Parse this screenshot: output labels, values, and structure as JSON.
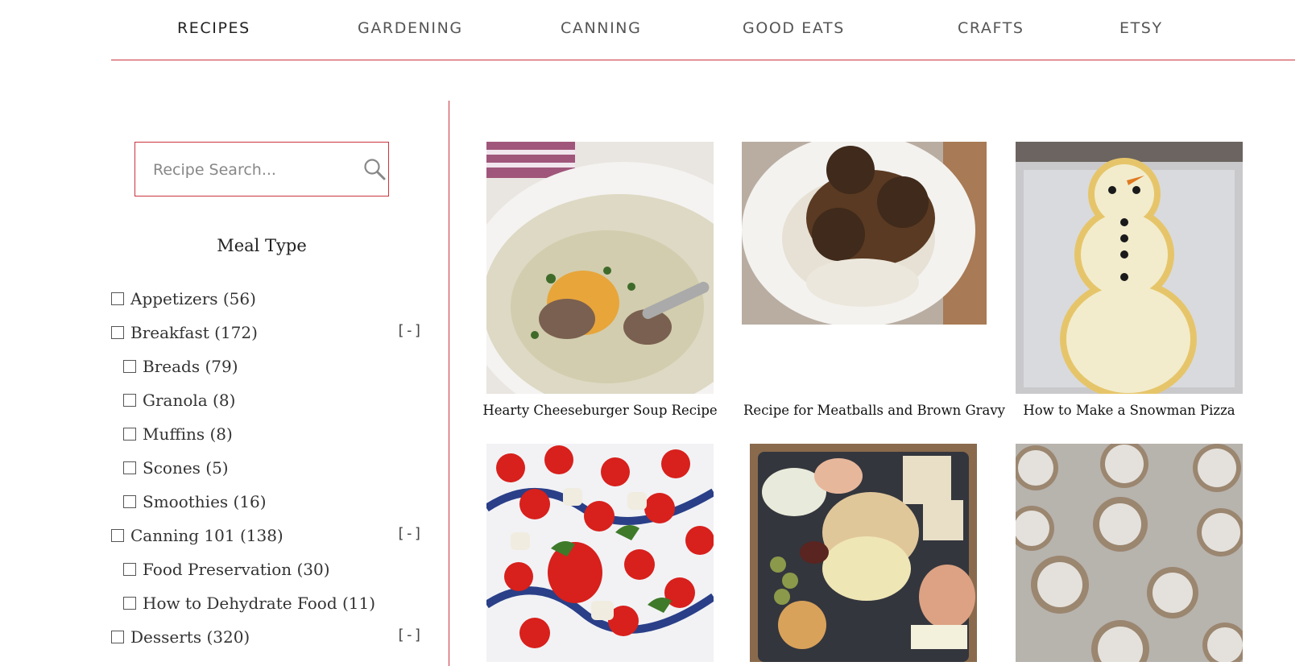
{
  "nav": {
    "items": [
      {
        "label": "RECIPES",
        "active": true
      },
      {
        "label": "GARDENING",
        "active": false
      },
      {
        "label": "CANNING",
        "active": false
      },
      {
        "label": "GOOD EATS",
        "active": false
      },
      {
        "label": "CRAFTS",
        "active": false
      },
      {
        "label": "ETSY",
        "active": false
      }
    ],
    "accent_color": "#c9353f"
  },
  "search": {
    "placeholder": "Recipe Search...",
    "value": "",
    "icon": "search-icon"
  },
  "sidebar": {
    "facet_title": "Meal Type",
    "items": [
      {
        "label": "Appetizers (56)",
        "level": 0,
        "toggle": ""
      },
      {
        "label": "Breakfast (172)",
        "level": 0,
        "toggle": "[-]"
      },
      {
        "label": "Breads (79)",
        "level": 1,
        "toggle": ""
      },
      {
        "label": "Granola (8)",
        "level": 1,
        "toggle": ""
      },
      {
        "label": "Muffins (8)",
        "level": 1,
        "toggle": ""
      },
      {
        "label": "Scones (5)",
        "level": 1,
        "toggle": ""
      },
      {
        "label": "Smoothies (16)",
        "level": 1,
        "toggle": ""
      },
      {
        "label": "Canning 101 (138)",
        "level": 0,
        "toggle": "[-]"
      },
      {
        "label": "Food Preservation (30)",
        "level": 1,
        "toggle": ""
      },
      {
        "label": "How to Dehydrate Food (11)",
        "level": 1,
        "toggle": ""
      },
      {
        "label": "Desserts (320)",
        "level": 0,
        "toggle": "[-]"
      }
    ]
  },
  "recipes": [
    {
      "title": "Hearty Cheeseburger Soup Recipe",
      "image": "soup-photo"
    },
    {
      "title": "Recipe for Meatballs and Brown Gravy",
      "image": "meatballs-photo"
    },
    {
      "title": "How to Make a Snowman Pizza",
      "image": "snowman-pizza-photo"
    },
    {
      "title": "",
      "image": "caprese-skewers-photo"
    },
    {
      "title": "",
      "image": "charcuterie-board-photo"
    },
    {
      "title": "",
      "image": "crinkle-cookies-photo"
    }
  ]
}
